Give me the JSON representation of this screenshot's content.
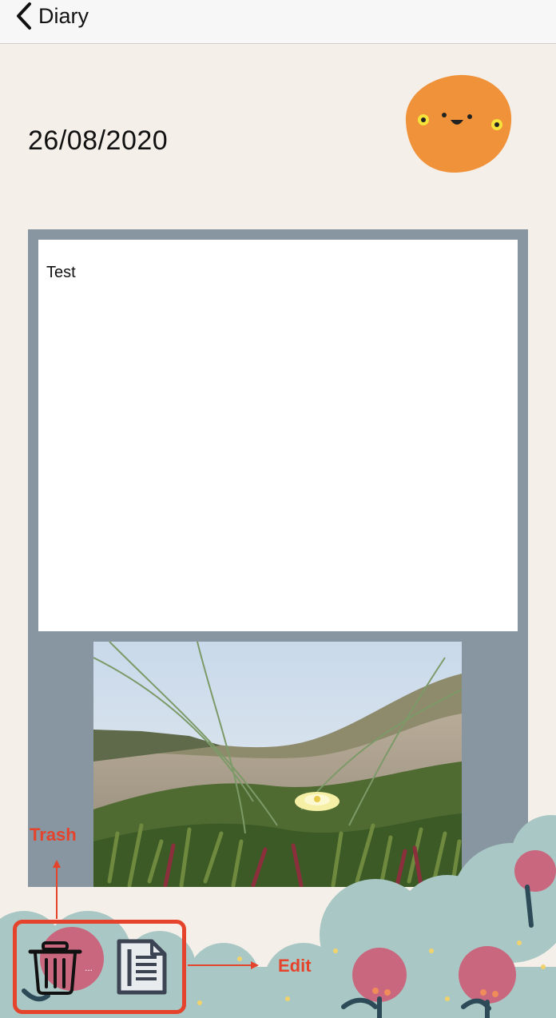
{
  "nav": {
    "back_label": "Diary"
  },
  "entry": {
    "date": "26/08/2020",
    "note_text": "Test",
    "mood": "happy-face"
  },
  "annotations": {
    "trash": "Trash",
    "edit": "Edit"
  },
  "toolbar": {
    "more_glyph": "..."
  },
  "colors": {
    "background": "#f4efe9",
    "panel": "#8796a1",
    "mood": "#f0923a",
    "annotation": "#e5432b",
    "toolbar_icon": "#3c4454"
  }
}
